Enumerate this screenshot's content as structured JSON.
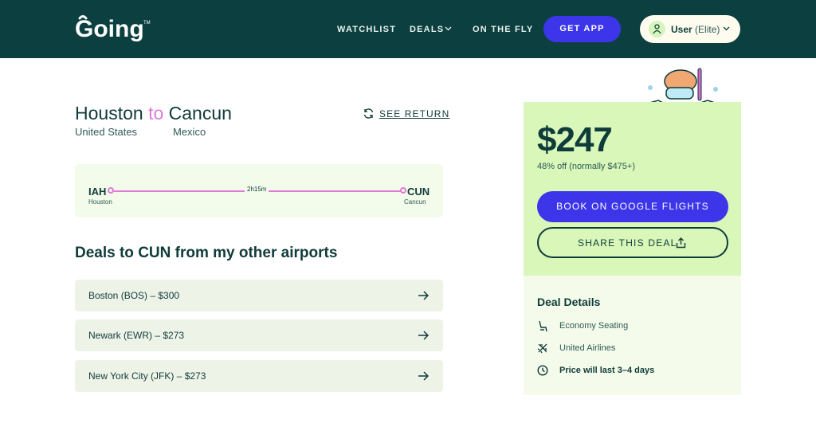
{
  "header": {
    "logo_text": "Going",
    "nav": {
      "watchlist": "WATCHLIST",
      "deals": "DEALS",
      "on_the_fly": "ON THE FLY"
    },
    "get_app": "GET APP",
    "user": {
      "name": "User",
      "tier": "(Elite)"
    }
  },
  "route": {
    "origin_city": "Houston",
    "connector": "to",
    "destination_city": "Cancun",
    "origin_country": "United States",
    "destination_country": "Mexico",
    "see_return": "SEE RETURN"
  },
  "flight": {
    "origin_code": "IAH",
    "origin_city": "Houston",
    "destination_code": "CUN",
    "destination_city": "Cancun",
    "duration": "2h15m"
  },
  "other_airports": {
    "title": "Deals to CUN from my other airports",
    "deals": [
      {
        "label": "Boston (BOS) – $300"
      },
      {
        "label": "Newark (EWR) – $273"
      },
      {
        "label": "New York City (JFK) – $273"
      }
    ]
  },
  "price_panel": {
    "price": "$247",
    "discount": "48% off (normally $475+)",
    "book_label": "BOOK ON GOOGLE FLIGHTS",
    "share_label": "SHARE THIS DEAL"
  },
  "deal_details": {
    "title": "Deal Details",
    "items": [
      {
        "icon": "seat-icon",
        "label": "Economy Seating"
      },
      {
        "icon": "plane-icon",
        "label": "United Airlines"
      },
      {
        "icon": "clock-icon",
        "label": "Price will last 3–4 days"
      }
    ]
  },
  "colors": {
    "header_bg": "#0c4040",
    "accent_blue": "#3c35ea",
    "accent_pink": "#e07ad8",
    "price_panel_bg": "#d8f7b9",
    "text_dark": "#0f3b3a"
  }
}
